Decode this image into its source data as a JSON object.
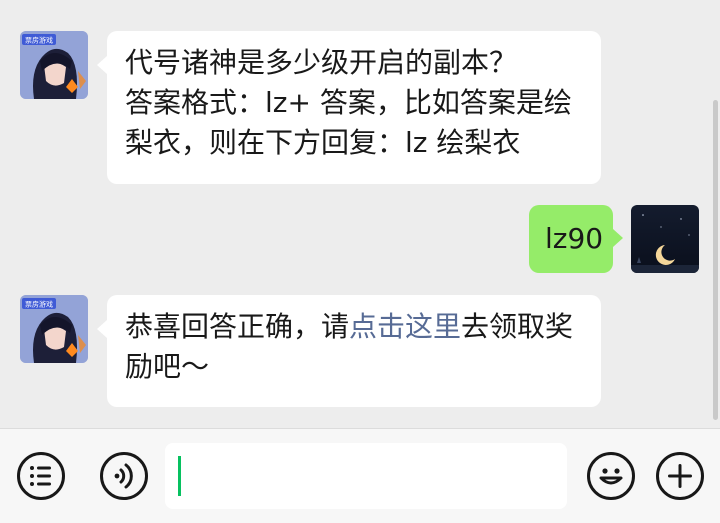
{
  "messages": [
    {
      "side": "incoming",
      "lines": [
        "代号诸神是多少级开启的副本？",
        "答案格式：lz+ 答案，比如答案是绘",
        "梨衣，则在下方回复：lz 绘梨衣"
      ]
    },
    {
      "side": "outgoing",
      "text": "lz90"
    },
    {
      "side": "incoming",
      "line1_before": "恭喜回答正确，请",
      "line1_link": "点击这里",
      "line1_after": "去领取奖",
      "line2": "励吧～"
    }
  ],
  "avatars": {
    "game_badge_text": "票房游戏"
  },
  "toolbar": {
    "menu_icon": "list-icon",
    "voice_icon": "voice-icon",
    "emoji_icon": "emoji-icon",
    "add_icon": "plus-icon",
    "input_value": ""
  },
  "colors": {
    "incoming_bubble": "#ffffff",
    "outgoing_bubble": "#95ec69",
    "link": "#576b95",
    "caret": "#07c160"
  }
}
